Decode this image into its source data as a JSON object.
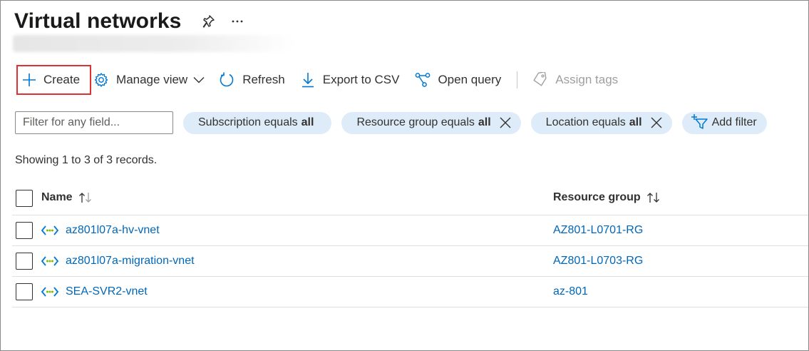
{
  "page": {
    "title": "Virtual networks"
  },
  "toolbar": {
    "create_label": "Create",
    "manage_view_label": "Manage view",
    "refresh_label": "Refresh",
    "export_label": "Export to CSV",
    "open_query_label": "Open query",
    "assign_tags_label": "Assign tags"
  },
  "filters": {
    "search_placeholder": "Filter for any field...",
    "pills": [
      {
        "label": "Subscription equals",
        "value": "all"
      },
      {
        "label": "Resource group equals",
        "value": "all"
      },
      {
        "label": "Location equals",
        "value": "all"
      }
    ],
    "add_filter_label": "Add filter"
  },
  "records_text": "Showing 1 to 3 of 3 records.",
  "table": {
    "columns": [
      "Name",
      "Resource group"
    ],
    "rows": [
      {
        "name": "az801l07a-hv-vnet",
        "resource_group": "AZ801-L0701-RG"
      },
      {
        "name": "az801l07a-migration-vnet",
        "resource_group": "AZ801-L0703-RG"
      },
      {
        "name": "SEA-SVR2-vnet",
        "resource_group": "az-801"
      }
    ]
  },
  "colors": {
    "accent": "#0078d4",
    "link": "#0067b8",
    "pill_bg": "#deecf9",
    "highlight_border": "#e0302f",
    "vnet_green": "#7fba00"
  },
  "icons": [
    "pin-icon",
    "more-icon",
    "plus-icon",
    "gear-icon",
    "chevron-down-icon",
    "refresh-icon",
    "download-icon",
    "query-icon",
    "tag-icon",
    "close-icon",
    "filter-add-icon",
    "sort-icon",
    "vnet-icon"
  ]
}
